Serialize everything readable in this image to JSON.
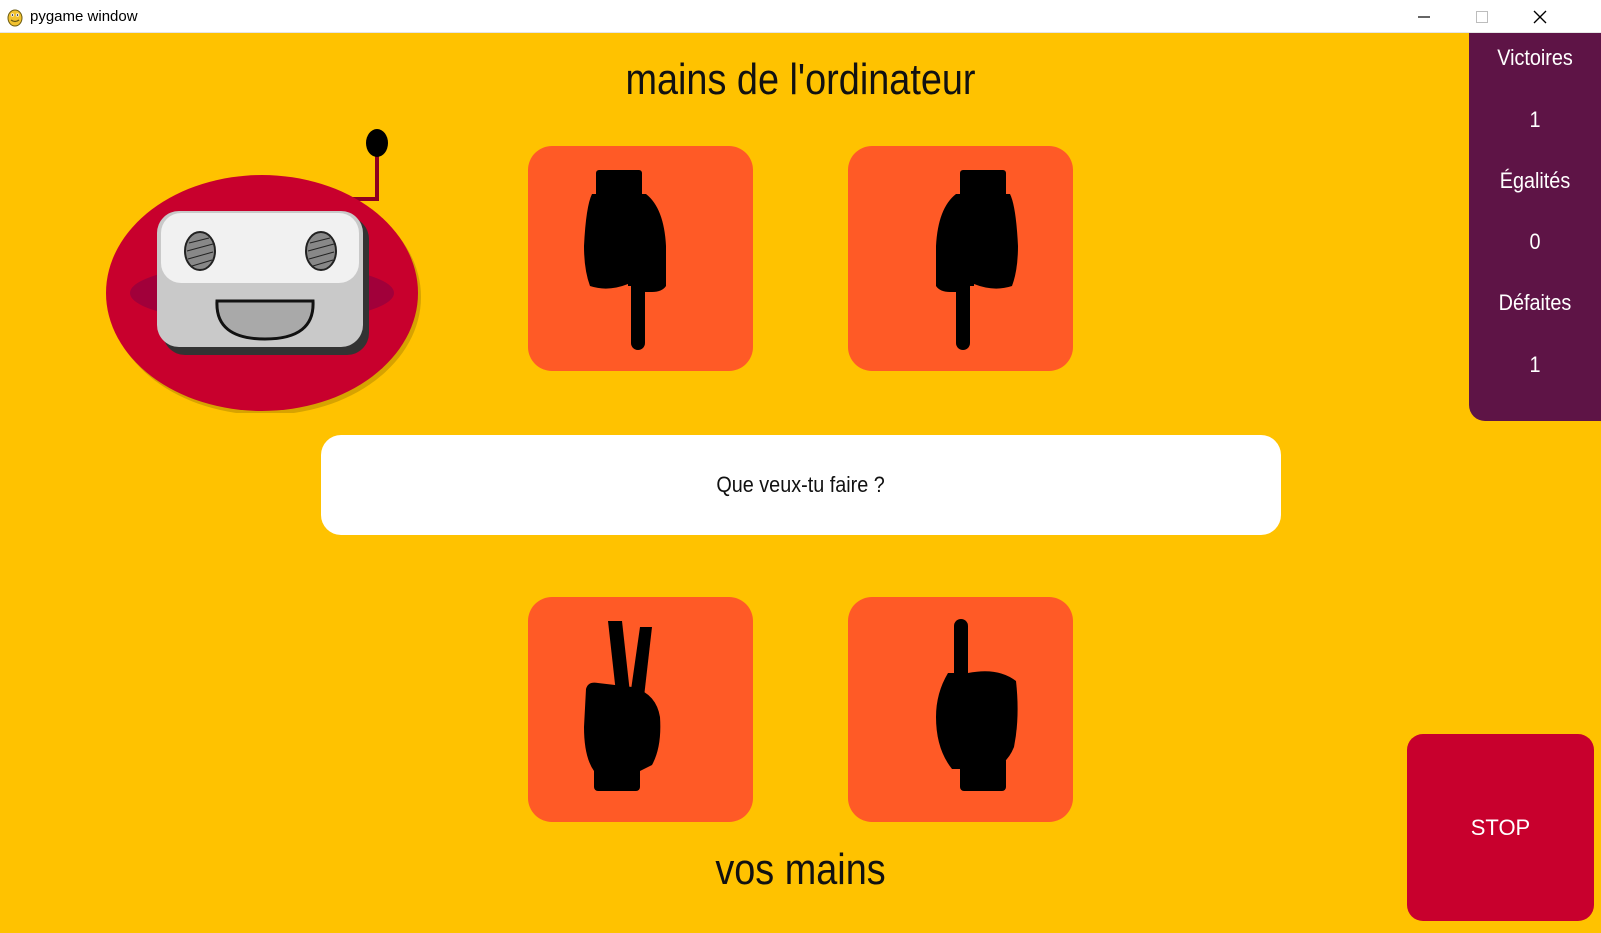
{
  "window": {
    "title": "pygame window",
    "icon": "pygame-snake-icon",
    "controls": [
      "minimize-icon",
      "maximize-icon",
      "close-icon"
    ]
  },
  "game": {
    "background_color": "#ffc200",
    "computer_heading": "mains de l'ordinateur",
    "player_heading": "vos mains",
    "message": "Que veux-tu faire ?",
    "card_color": "#ff5a26",
    "computer_hands": [
      {
        "gesture": "pointing-down-hand-icon"
      },
      {
        "gesture": "pointing-down-hand-icon"
      }
    ],
    "player_hands": [
      {
        "gesture": "victory-hand-icon"
      },
      {
        "gesture": "pointing-up-hand-icon"
      }
    ],
    "robot": "robot-face-icon"
  },
  "scores": {
    "panel_color": "#5e1446",
    "wins_label": "Victoires",
    "wins_value": "1",
    "ties_label": "Égalités",
    "ties_value": "0",
    "losses_label": "Défaites",
    "losses_value": "1"
  },
  "stop_button": {
    "label": "STOP",
    "color": "#c8002d"
  }
}
